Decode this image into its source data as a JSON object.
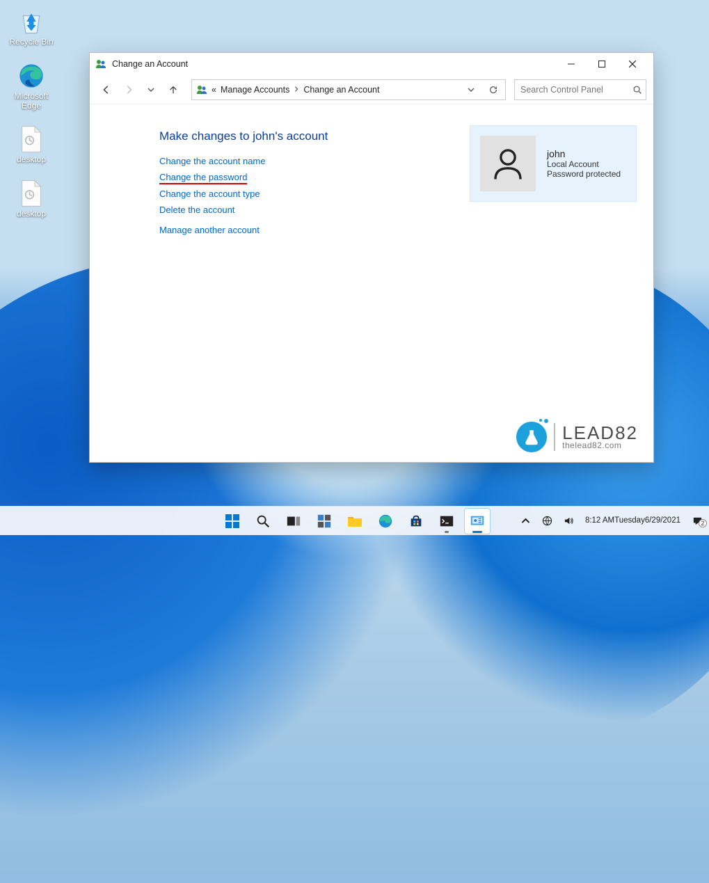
{
  "desktop": {
    "icons": [
      {
        "name": "recycle-bin",
        "label": "Recycle Bin"
      },
      {
        "name": "microsoft-edge",
        "label": "Microsoft Edge"
      },
      {
        "name": "desktop-ini-1",
        "label": "desktop"
      },
      {
        "name": "desktop-ini-2",
        "label": "desktop"
      }
    ]
  },
  "window": {
    "title": "Change an Account",
    "breadcrumb_prefix": "«",
    "breadcrumb": [
      "Manage Accounts",
      "Change an Account"
    ],
    "search_placeholder": "Search Control Panel",
    "heading": "Make changes to john's account",
    "links": {
      "change_name": "Change the account name",
      "change_password": "Change the password",
      "change_type": "Change the account type",
      "delete_account": "Delete the account",
      "manage_another": "Manage another account"
    },
    "user": {
      "name": "john",
      "line1": "Local Account",
      "line2": "Password protected"
    }
  },
  "watermark": {
    "main": "LEAD82",
    "sub": "thelead82.com"
  },
  "taskbar": {
    "time": "8:12 AM",
    "day": "Tuesday",
    "date": "6/29/2021",
    "notif_count": "2"
  }
}
